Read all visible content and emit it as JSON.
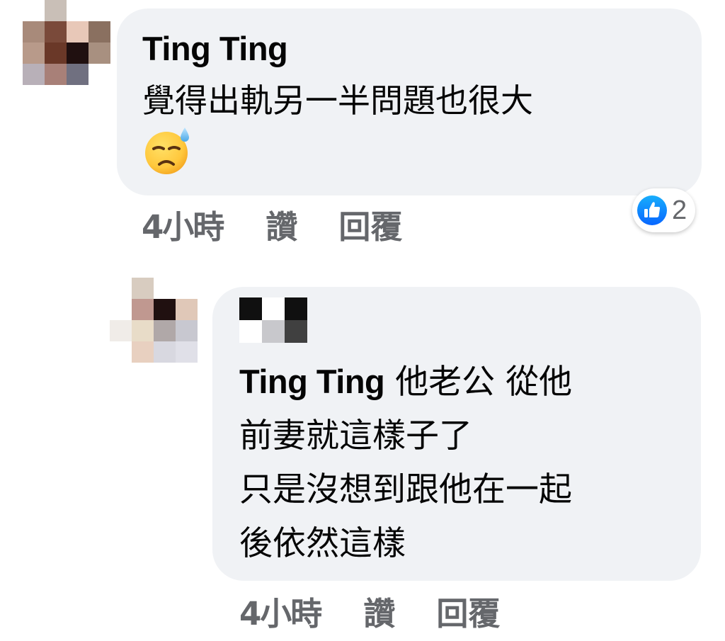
{
  "comments": [
    {
      "author": "Ting Ting",
      "text": "覺得出軌另一半問題也很大",
      "emoji": "downcast-face-with-sweat",
      "timestamp": "4小時",
      "like_label": "讚",
      "reply_label": "回覆",
      "reaction_count": "2"
    },
    {
      "author": "Ting Ting",
      "text_line1_suffix": "他老公 從他",
      "text_line2": "前妻就這樣子了",
      "text_line3": "只是沒想到跟他在一起",
      "text_line4": "後依然這樣",
      "timestamp": "4小時",
      "like_label": "讚",
      "reply_label": "回覆"
    }
  ],
  "colors": {
    "bubble_bg": "#f0f2f5",
    "secondary_text": "#65676b",
    "like_blue": "#1877f2"
  },
  "avatars": {
    "first": [
      "#ffffff",
      "#c9bfb7",
      "#ffffff",
      "#ffffff",
      "#a88a7a",
      "#7a4a3a",
      "#e8c8b8",
      "#8a7060",
      "#b89a8a",
      "#6a3828",
      "#201010",
      "#a89080",
      "#b8b0b8",
      "#a88078",
      "#707080",
      "#ffffff"
    ],
    "second": [
      "#ffffff",
      "#d8ccc0",
      "#ffffff",
      "#ffffff",
      "#ffffff",
      "#c09890",
      "#201010",
      "#e0c8b8",
      "#f0ece8",
      "#e8dcc8",
      "#b0a8a8",
      "#c8c8d0",
      "#ffffff",
      "#e8d0c0",
      "#d8d8e0",
      "#e0e0e8"
    ],
    "second_name_blocks": [
      "#101010",
      "#ffffff",
      "#101010",
      "#ffffff",
      "#c8c8cc",
      "#404040"
    ]
  }
}
